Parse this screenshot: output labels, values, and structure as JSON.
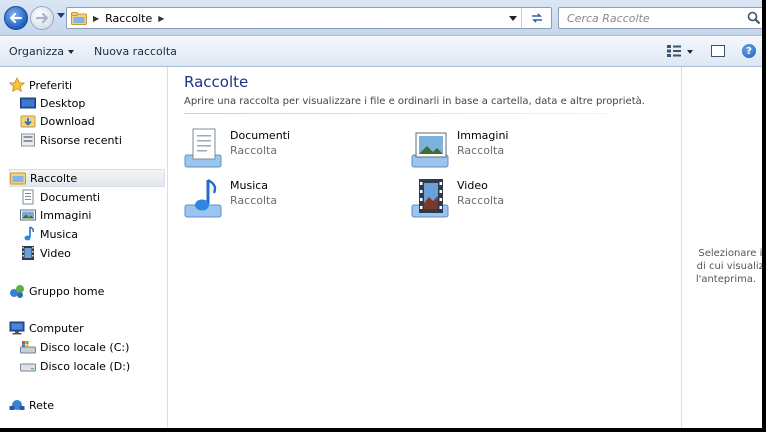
{
  "address_bar": {
    "breadcrumb": [
      "Raccolte"
    ],
    "search_placeholder": "Cerca Raccolte"
  },
  "command_bar": {
    "organize": "Organizza",
    "new_library": "Nuova raccolta"
  },
  "nav": {
    "favorites": {
      "label": "Preferiti",
      "items": [
        "Desktop",
        "Download",
        "Risorse recenti"
      ]
    },
    "libraries": {
      "label": "Raccolte",
      "items": [
        "Documenti",
        "Immagini",
        "Musica",
        "Video"
      ]
    },
    "homegroup": "Gruppo home",
    "computer": {
      "label": "Computer",
      "items": [
        "Disco locale (C:)",
        "Disco locale (D:)"
      ]
    },
    "network": "Rete"
  },
  "content": {
    "title": "Raccolte",
    "subtitle": "Aprire una raccolta per visualizzare i file e ordinarli in base a cartella, data e altre proprietà.",
    "libraries": [
      {
        "name": "Documenti",
        "kind": "Raccolta",
        "icon": "documents-library-icon"
      },
      {
        "name": "Immagini",
        "kind": "Raccolta",
        "icon": "pictures-library-icon"
      },
      {
        "name": "Musica",
        "kind": "Raccolta",
        "icon": "music-library-icon"
      },
      {
        "name": "Video",
        "kind": "Raccolta",
        "icon": "videos-library-icon"
      }
    ]
  },
  "preview": {
    "line1": "Selezionare il file",
    "line2": "di cui visualizzare",
    "line3": "l'anteprima."
  },
  "colors": {
    "title_blue": "#1e3287",
    "chrome_blue": "#dbe6f4",
    "selected_nav": "#e3e8ee"
  }
}
